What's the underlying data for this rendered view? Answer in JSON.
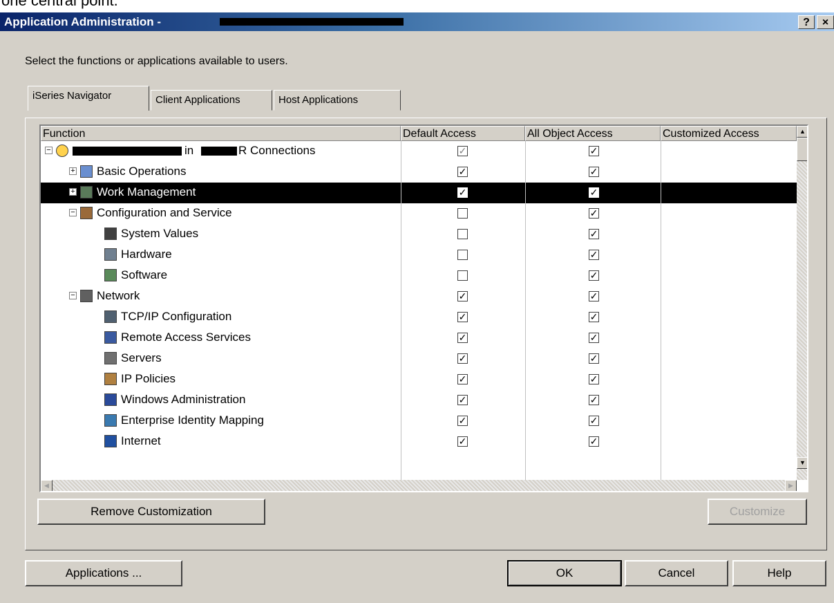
{
  "top_fragment": "one central point.",
  "window": {
    "title": "Application Administration - ",
    "help_button": "?",
    "close_button": "×"
  },
  "instruction": "Select the functions or applications available to users.",
  "tabs": [
    {
      "label": "iSeries Navigator",
      "active": true
    },
    {
      "label": "Client Applications",
      "active": false
    },
    {
      "label": "Host Applications",
      "active": false
    }
  ],
  "columns": [
    "Function",
    "Default Access",
    "All Object Access",
    "Customized Access"
  ],
  "rows": [
    {
      "label": "in",
      "label_suffix": "R Connections",
      "expander": "minus",
      "icon": "connection-icon",
      "default": "checked",
      "all_object": "checked",
      "selected": false,
      "redacted": true
    },
    {
      "label": "Basic Operations",
      "expander": "plus",
      "icon": "basic-operations-icon",
      "default": "checked",
      "all_object": "checked",
      "selected": false
    },
    {
      "label": "Work Management",
      "expander": "plus",
      "icon": "work-management-icon",
      "default": "checked",
      "all_object": "checked",
      "selected": true
    },
    {
      "label": "Configuration and Service",
      "expander": "minus",
      "icon": "configuration-icon",
      "default": "unchecked",
      "all_object": "checked",
      "selected": false
    },
    {
      "label": "System Values",
      "expander": "none",
      "icon": "system-values-icon",
      "default": "unchecked",
      "all_object": "checked",
      "selected": false
    },
    {
      "label": "Hardware",
      "expander": "none",
      "icon": "hardware-icon",
      "default": "unchecked",
      "all_object": "checked",
      "selected": false
    },
    {
      "label": "Software",
      "expander": "none",
      "icon": "software-icon",
      "default": "unchecked",
      "all_object": "checked",
      "selected": false
    },
    {
      "label": "Network",
      "expander": "minus",
      "icon": "network-icon",
      "default": "checked",
      "all_object": "checked",
      "selected": false
    },
    {
      "label": "TCP/IP Configuration",
      "expander": "none",
      "icon": "tcpip-icon",
      "default": "checked",
      "all_object": "checked",
      "selected": false
    },
    {
      "label": "Remote Access Services",
      "expander": "none",
      "icon": "remote-access-icon",
      "default": "checked",
      "all_object": "checked",
      "selected": false
    },
    {
      "label": "Servers",
      "expander": "none",
      "icon": "servers-icon",
      "default": "checked",
      "all_object": "checked",
      "selected": false
    },
    {
      "label": "IP Policies",
      "expander": "none",
      "icon": "ip-policies-icon",
      "default": "checked",
      "all_object": "checked",
      "selected": false
    },
    {
      "label": "Windows Administration",
      "expander": "none",
      "icon": "windows-admin-icon",
      "default": "checked",
      "all_object": "checked",
      "selected": false
    },
    {
      "label": "Enterprise Identity Mapping",
      "expander": "none",
      "icon": "eim-icon",
      "default": "checked",
      "all_object": "checked",
      "selected": false
    },
    {
      "label": "Internet",
      "expander": "none",
      "icon": "internet-icon",
      "default": "checked",
      "all_object": "checked",
      "selected": false
    }
  ],
  "buttons": {
    "remove_customization": "Remove Customization",
    "customize": "Customize",
    "applications": "Applications ...",
    "ok": "OK",
    "cancel": "Cancel",
    "help": "Help"
  },
  "colors": {
    "title_start": "#0a246a",
    "title_end": "#a6caf0",
    "dialog": "#d4d0c8",
    "selection": "#000000"
  }
}
